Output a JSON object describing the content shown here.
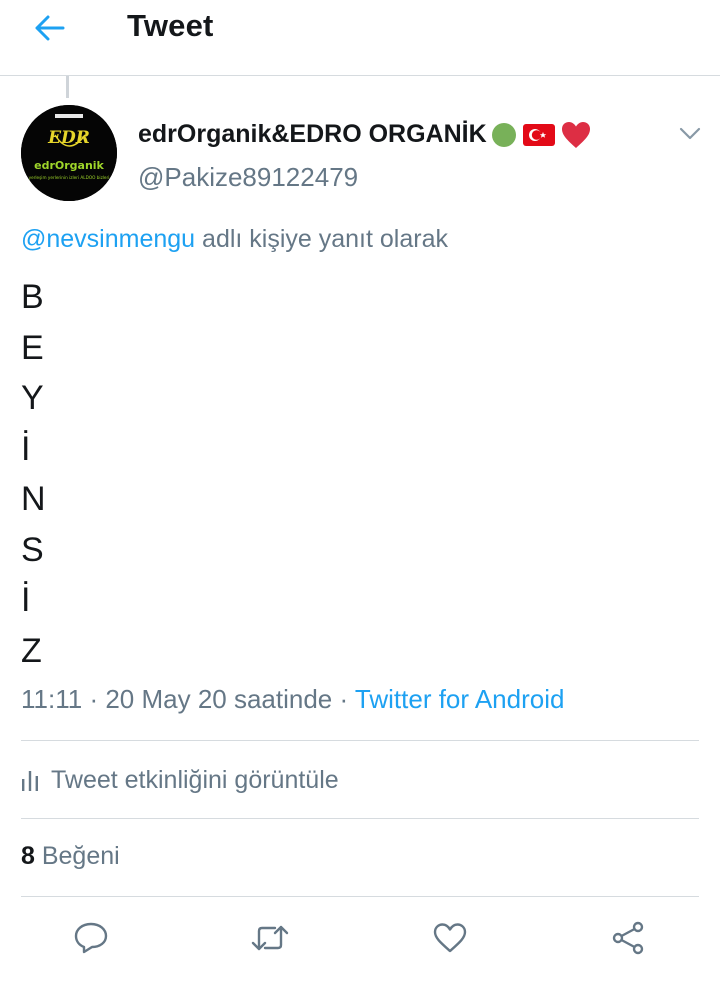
{
  "header": {
    "title": "Tweet",
    "back_icon": "arrow-left-icon",
    "accent_color": "#1da1f2"
  },
  "author": {
    "display_name": "edrOrganik&EDRO ORGANİK",
    "name_emojis": [
      "green-circle-emoji",
      "turkey-flag-emoji",
      "red-heart-emoji"
    ],
    "handle": "@Pakize89122479",
    "avatar": {
      "logo_letters": "EDR",
      "brand_text": "edrOrganik",
      "tagline": "yerleşim yerlerinin izleri ALDOO bizleri"
    }
  },
  "reply_context": {
    "mention": "@nevsinmengu",
    "suffix": " adlı kişiye yanıt olarak"
  },
  "tweet": {
    "letters": [
      "B",
      "E",
      "Y",
      "İ",
      "N",
      "S",
      "İ",
      "Z"
    ]
  },
  "meta": {
    "time": "11:11",
    "separator1": " · ",
    "date": "20 May 20 saatinde",
    "separator2": " · ",
    "source": "Twitter for Android"
  },
  "activity": {
    "label": "Tweet etkinliğini görüntüle",
    "icon": "bar-chart-icon"
  },
  "likes": {
    "count": "8",
    "label": " Beğeni"
  },
  "actions": [
    {
      "name": "reply",
      "icon": "speech-bubble-icon"
    },
    {
      "name": "retweet",
      "icon": "retweet-icon"
    },
    {
      "name": "like",
      "icon": "heart-outline-icon"
    },
    {
      "name": "share",
      "icon": "share-icon"
    }
  ],
  "colors": {
    "text_primary": "#14171a",
    "text_secondary": "#657786",
    "link": "#1da1f2",
    "divider": "#d6dbdf"
  }
}
